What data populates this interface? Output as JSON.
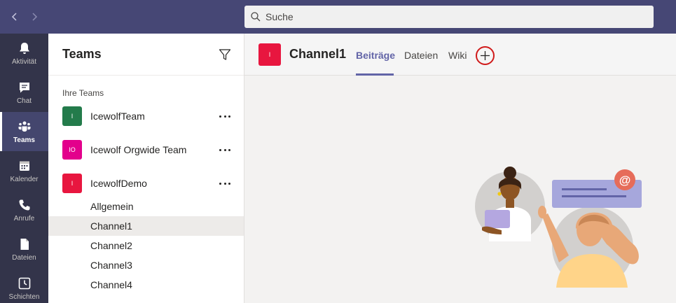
{
  "colors": {
    "topbar": "#464775",
    "rail": "#33344a",
    "accent": "#6264a7",
    "add_tab_ring": "#d01a1a"
  },
  "search": {
    "placeholder": "Suche",
    "icon": "search-icon"
  },
  "nav": {
    "back_icon": "chevron-left-icon",
    "forward_icon": "chevron-right-icon"
  },
  "rail": {
    "items": [
      {
        "label": "Aktivität",
        "icon": "bell-icon"
      },
      {
        "label": "Chat",
        "icon": "chat-icon"
      },
      {
        "label": "Teams",
        "icon": "teams-icon",
        "active": true
      },
      {
        "label": "Kalender",
        "icon": "calendar-icon"
      },
      {
        "label": "Anrufe",
        "icon": "phone-icon"
      },
      {
        "label": "Dateien",
        "icon": "file-icon"
      },
      {
        "label": "Schichten",
        "icon": "clock-icon"
      }
    ]
  },
  "panel": {
    "title": "Teams",
    "section_label": "Ihre Teams",
    "teams": [
      {
        "name": "IcewolfTeam",
        "initials": "I",
        "color": "#237b4b"
      },
      {
        "name": "Icewolf Orgwide Team",
        "initials": "IO",
        "color": "#e3008c"
      },
      {
        "name": "IcewolfDemo",
        "initials": "I",
        "color": "#e8163f"
      }
    ],
    "channels": [
      "Allgemein",
      "Channel1",
      "Channel2",
      "Channel3",
      "Channel4"
    ],
    "selected_channel": "Channel1"
  },
  "content": {
    "channel_initials": "I",
    "channel_title": "Channel1",
    "tabs": [
      "Beiträge",
      "Dateien",
      "Wiki"
    ],
    "active_tab": "Beiträge"
  }
}
